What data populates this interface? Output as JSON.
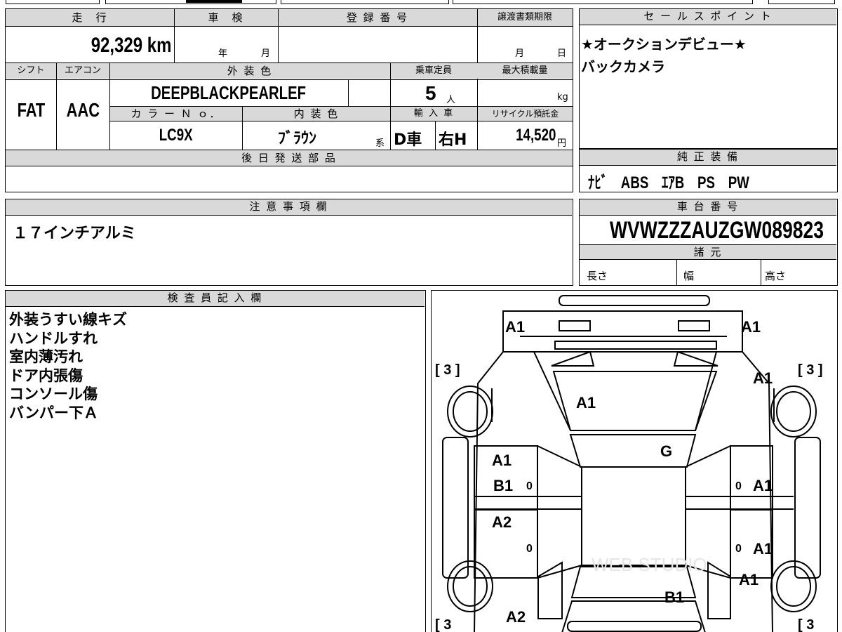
{
  "top_block": {
    "headers": {
      "mileage": "走　行",
      "inspection": "車　検",
      "registration": "登 録 番 号",
      "transfer_deadline": "譲渡書類期限",
      "shift": "シフト",
      "aircon": "エアコン",
      "exterior_color": "外 装 色",
      "capacity": "乗車定員",
      "max_load": "最大積載量",
      "color_no": "カ ラ ー Ｎ ｏ．",
      "interior_color": "内 装 色",
      "import": "輸 入 車",
      "recycle": "リサイクル預託金",
      "later_parts": "後 日 発 送 部 品"
    },
    "mileage_value": "92,329",
    "mileage_unit": "km",
    "inspection_year": "年",
    "inspection_month": "月",
    "transfer_month": "月",
    "transfer_day": "日",
    "shift_value": "FAT",
    "aircon_value": "AAC",
    "exterior_color_value": "DEEPBLACKPEARLEF",
    "capacity_value": "5",
    "capacity_unit": "人",
    "max_load_unit": "kg",
    "color_no_value": "LC9X",
    "interior_color_value": "ﾌﾞﾗｳﾝ",
    "interior_color_suffix": "系",
    "import_dealer": "D車",
    "import_handle": "右H",
    "recycle_value": "14,520",
    "recycle_unit": "円"
  },
  "sales_points": {
    "header": "セ ー ル ス ポ イ ン ト",
    "lines": [
      "★オークションデビュー★",
      "バックカメラ"
    ]
  },
  "equipment": {
    "header": "純 正 装 備",
    "value": "ﾅﾋﾞ　ABS　ｴｱB　PS　PW"
  },
  "notes": {
    "header": "注 意 事 項 欄",
    "value": "１７インチアルミ"
  },
  "chassis": {
    "header": "車 台 番 号",
    "value": "WVWZZZAUZGW089823",
    "specs_header": "諸 元",
    "length": "長さ",
    "width": "幅",
    "height": "高さ"
  },
  "inspector": {
    "header": "検 査 員 記 入 欄",
    "lines": [
      "外装うすい線キズ",
      "ハンドルすれ",
      "室内薄汚れ",
      "ドア内張傷",
      "コンソール傷",
      "バンパー下Ａ"
    ]
  },
  "diagram": {
    "marks": {
      "front_left": "A1",
      "front_right": "A1",
      "hood": "A1",
      "right_fender": "A1",
      "windshield": "G",
      "left_front_door_1": "A1",
      "left_front_door_2": "B1",
      "left_rear_door": "A2",
      "right_front_door": "A1",
      "right_rear_door": "A1",
      "right_quarter": "A1",
      "trunk": "B1",
      "rear_left": "A2"
    },
    "tire_fl": "[ 3 ]",
    "tire_fr": "[ 3 ]",
    "tire_rl": "[ 3",
    "tire_rr": "[ 3",
    "zero": "0",
    "watermark": "WEB STUDIO"
  }
}
